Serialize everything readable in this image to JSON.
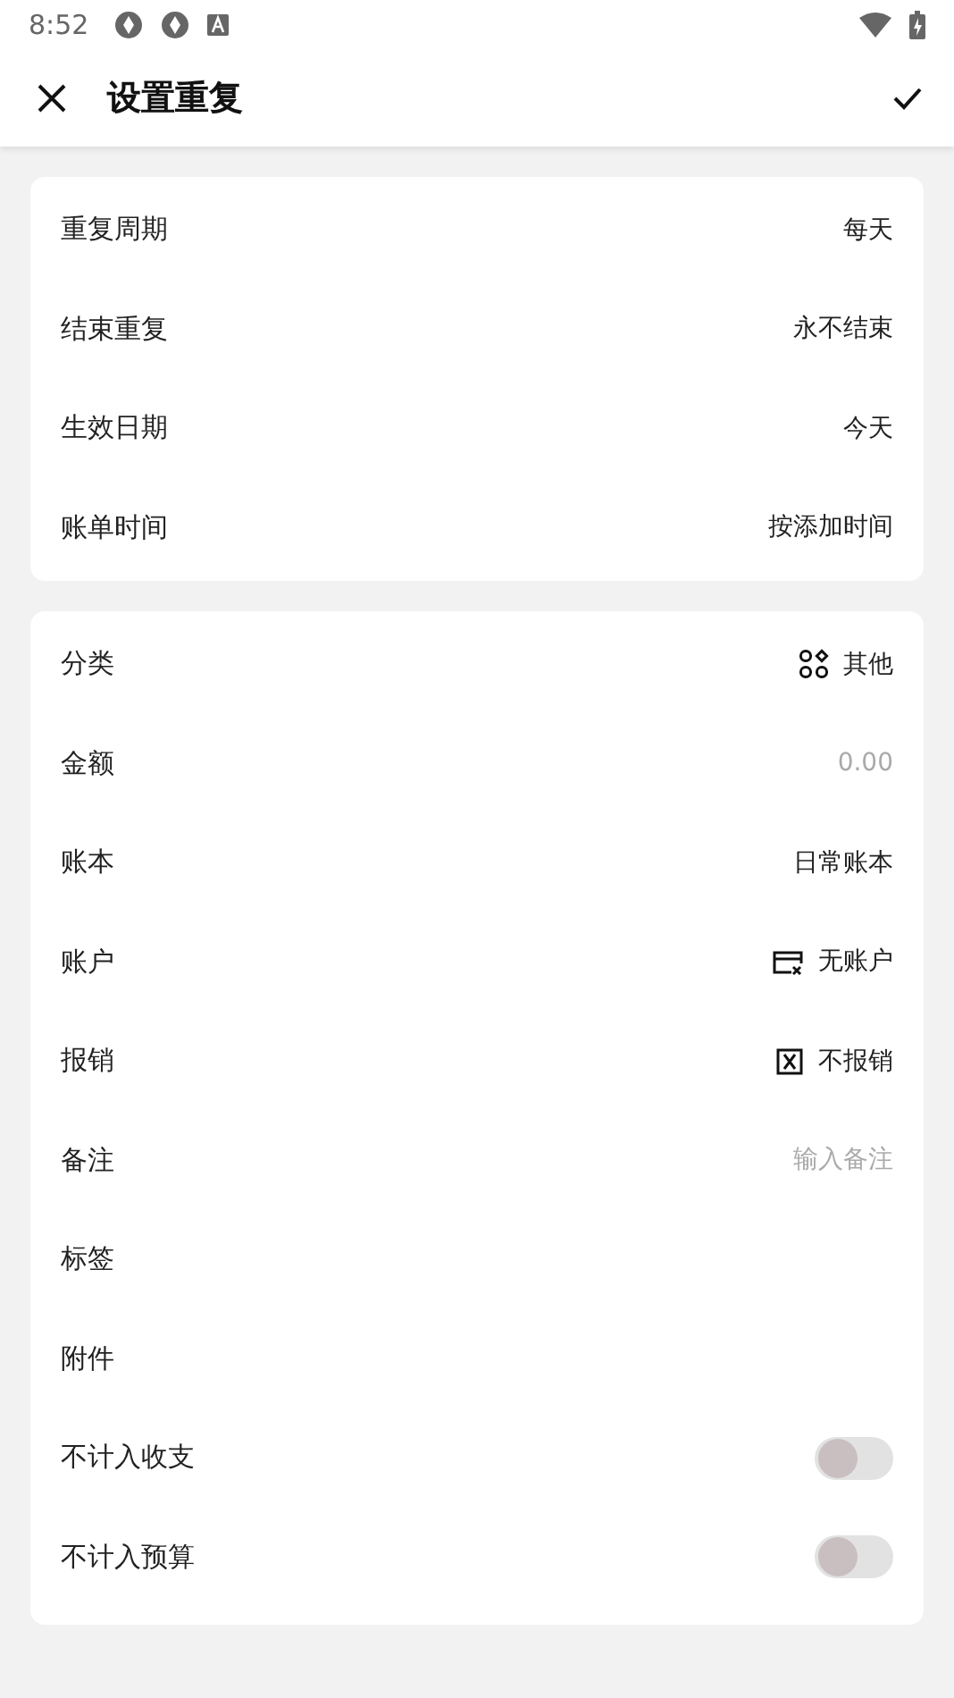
{
  "status_bar": {
    "time": "8:52"
  },
  "app_bar": {
    "title": "设置重复"
  },
  "sections": [
    {
      "rows": [
        {
          "label": "重复周期",
          "kind": "value",
          "value": "每天"
        },
        {
          "label": "结束重复",
          "kind": "value",
          "value": "永不结束"
        },
        {
          "label": "生效日期",
          "kind": "value",
          "value": "今天"
        },
        {
          "label": "账单时间",
          "kind": "value",
          "value": "按添加时间"
        }
      ]
    },
    {
      "rows": [
        {
          "label": "分类",
          "kind": "category",
          "value": "其他"
        },
        {
          "label": "金额",
          "kind": "placeholder",
          "placeholder": "0.00"
        },
        {
          "label": "账本",
          "kind": "value",
          "value": "日常账本"
        },
        {
          "label": "账户",
          "kind": "account",
          "value": "无账户"
        },
        {
          "label": "报销",
          "kind": "reimburse",
          "value": "不报销"
        },
        {
          "label": "备注",
          "kind": "placeholder",
          "placeholder": "输入备注"
        },
        {
          "label": "标签",
          "kind": "empty"
        },
        {
          "label": "附件",
          "kind": "empty"
        },
        {
          "label": "不计入收支",
          "kind": "switch",
          "on": false
        },
        {
          "label": "不计入预算",
          "kind": "switch",
          "on": false
        }
      ]
    }
  ]
}
